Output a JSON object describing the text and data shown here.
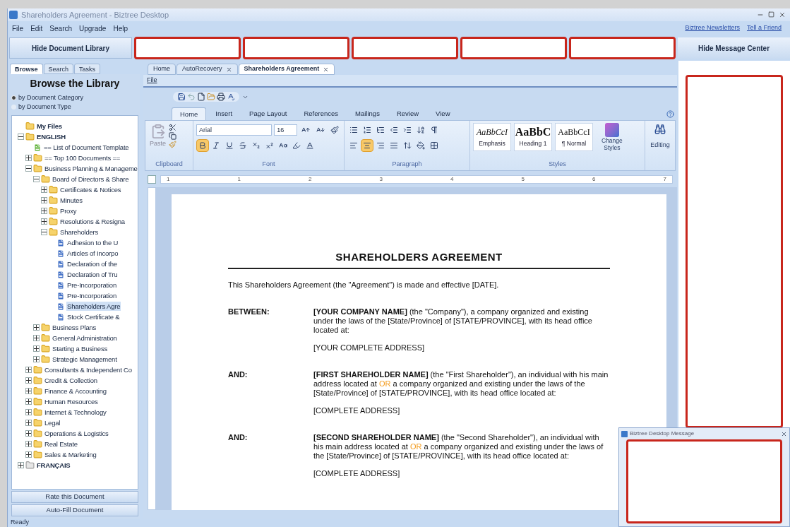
{
  "window": {
    "title": "Shareholders Agreement - Biztree Desktop"
  },
  "menu": [
    "File",
    "Edit",
    "Search",
    "Upgrade",
    "Help"
  ],
  "links": [
    "Biztree Newsletters",
    "Tell a Friend"
  ],
  "toolbar": {
    "left_button": "Hide Document Library",
    "right_button": "Hide Message Center"
  },
  "library": {
    "tabs": [
      {
        "label": "Browse",
        "selected": true
      },
      {
        "label": "Search",
        "selected": false
      },
      {
        "label": "Tasks",
        "selected": false
      }
    ],
    "heading": "Browse the Library",
    "options": [
      {
        "label": "by Document Category",
        "selected": true
      },
      {
        "label": "by Document Type",
        "selected": false
      }
    ],
    "tree": [
      {
        "label": "My Files",
        "kind": "folder",
        "bold": true,
        "selected": false
      },
      {
        "label": "ENGLISH",
        "kind": "folder",
        "bold": true,
        "expanded": true,
        "selected": false,
        "children": [
          {
            "label": "== List of Document Template",
            "kind": "list",
            "bold": false,
            "selected": false
          },
          {
            "label": "== Top 100 Documents ==",
            "kind": "folder",
            "bold": false,
            "expanded": false,
            "selected": false
          },
          {
            "label": "Business Planning & Manageme",
            "kind": "folder",
            "bold": false,
            "expanded": true,
            "selected": false,
            "children": [
              {
                "label": "Board of Directors & Share",
                "kind": "folder",
                "bold": false,
                "expanded": true,
                "selected": false,
                "children": [
                  {
                    "label": "Certificates & Notices",
                    "kind": "folder",
                    "bold": false,
                    "expanded": false,
                    "selected": false
                  },
                  {
                    "label": "Minutes",
                    "kind": "folder",
                    "bold": false,
                    "expanded": false,
                    "selected": false
                  },
                  {
                    "label": "Proxy",
                    "kind": "folder",
                    "bold": false,
                    "expanded": false,
                    "selected": false
                  },
                  {
                    "label": "Resolutions & Resigna",
                    "kind": "folder",
                    "bold": false,
                    "expanded": false,
                    "selected": false
                  },
                  {
                    "label": "Shareholders",
                    "kind": "folder",
                    "bold": false,
                    "expanded": true,
                    "selected": false,
                    "children": [
                      {
                        "label": "Adhesion to the U",
                        "kind": "document",
                        "bold": false,
                        "selected": false
                      },
                      {
                        "label": "Articles of Incorpo",
                        "kind": "document",
                        "bold": false,
                        "selected": false
                      },
                      {
                        "label": "Declaration of the",
                        "kind": "document",
                        "bold": false,
                        "selected": false
                      },
                      {
                        "label": "Declaration of Tru",
                        "kind": "document",
                        "bold": false,
                        "selected": false
                      },
                      {
                        "label": "Pre-Incorporation",
                        "kind": "document",
                        "bold": false,
                        "selected": false
                      },
                      {
                        "label": "Pre-Incorporation",
                        "kind": "document",
                        "bold": false,
                        "selected": false
                      },
                      {
                        "label": "Shareholders Agre",
                        "kind": "document",
                        "bold": false,
                        "selected": true
                      },
                      {
                        "label": "Stock Certificate &",
                        "kind": "document",
                        "bold": false,
                        "selected": false
                      }
                    ]
                  }
                ]
              },
              {
                "label": "Business Plans",
                "kind": "folder",
                "bold": false,
                "expanded": false,
                "selected": false
              },
              {
                "label": "General Administration",
                "kind": "folder",
                "bold": false,
                "expanded": false,
                "selected": false
              },
              {
                "label": "Starting a Business",
                "kind": "folder",
                "bold": false,
                "expanded": false,
                "selected": false
              },
              {
                "label": "Strategic Management",
                "kind": "folder",
                "bold": false,
                "expanded": false,
                "selected": false
              }
            ]
          },
          {
            "label": "Consultants & Independent Co",
            "kind": "folder",
            "bold": false,
            "expanded": false,
            "selected": false
          },
          {
            "label": "Credit & Collection",
            "kind": "folder",
            "bold": false,
            "expanded": false,
            "selected": false
          },
          {
            "label": "Finance & Accounting",
            "kind": "folder",
            "bold": false,
            "expanded": false,
            "selected": false
          },
          {
            "label": "Human Resources",
            "kind": "folder",
            "bold": false,
            "expanded": false,
            "selected": false
          },
          {
            "label": "Internet & Technology",
            "kind": "folder",
            "bold": false,
            "expanded": false,
            "selected": false
          },
          {
            "label": "Legal",
            "kind": "folder",
            "bold": false,
            "expanded": false,
            "selected": false
          },
          {
            "label": "Operations & Logistics",
            "kind": "folder",
            "bold": false,
            "expanded": false,
            "selected": false
          },
          {
            "label": "Real Estate",
            "kind": "folder",
            "bold": false,
            "expanded": false,
            "selected": false
          },
          {
            "label": "Sales & Marketing",
            "kind": "folder",
            "bold": false,
            "expanded": false,
            "selected": false
          }
        ]
      },
      {
        "label": "FRANÇAIS",
        "kind": "folder-grey",
        "bold": true,
        "expanded": false,
        "selected": false
      }
    ],
    "buttons": [
      "Rate this Document",
      "Auto-Fill Document"
    ]
  },
  "doc_tabs": [
    {
      "label": "Home",
      "closable": false,
      "selected": false
    },
    {
      "label": "AutoRecovery",
      "closable": true,
      "selected": false
    },
    {
      "label": "Shareholders Agreement",
      "closable": true,
      "selected": true
    }
  ],
  "file_menu": "File",
  "ribbon": {
    "tabs": [
      {
        "label": "Home",
        "selected": true
      },
      {
        "label": "Insert",
        "selected": false
      },
      {
        "label": "Page Layout",
        "selected": false
      },
      {
        "label": "References",
        "selected": false
      },
      {
        "label": "Mailings",
        "selected": false
      },
      {
        "label": "Review",
        "selected": false
      },
      {
        "label": "View",
        "selected": false
      }
    ],
    "paste": "Paste",
    "font_name": "Arial",
    "font_size": "16",
    "bold": true,
    "align_buttons": [
      {
        "kind": "left",
        "selected": false
      },
      {
        "kind": "center",
        "selected": true
      },
      {
        "kind": "right",
        "selected": false
      },
      {
        "kind": "justify",
        "selected": false
      }
    ],
    "styles": [
      {
        "preview": "AaBbCcI",
        "label": "Emphasis",
        "kind": "emphasis"
      },
      {
        "preview": "AaBbC",
        "label": "Heading 1",
        "kind": "heading"
      },
      {
        "preview": "AaBbCcI",
        "label": "¶ Normal",
        "kind": "normal"
      }
    ],
    "change_styles": [
      "Change",
      "Styles"
    ],
    "editing": "Editing",
    "groups": [
      "Clipboard",
      "Font",
      "Paragraph",
      "Styles"
    ],
    "ruler": [
      "1",
      "1",
      "2",
      "3",
      "4",
      "5",
      "6",
      "7"
    ]
  },
  "document": {
    "title": "SHAREHOLDERS AGREEMENT",
    "intro": "This Shareholders Agreement (the \"Agreement\") is made and effective [DATE].",
    "parties": [
      {
        "label": "BETWEEN:",
        "text": [
          {
            "kind": "bold",
            "text": "[YOUR COMPANY NAME]"
          },
          {
            "kind": "plain",
            "text": " (the \"Company\"), a company organized and existing under the laws of the [State/Province] of [STATE/PROVINCE], with its head office located at:"
          }
        ],
        "address": "[YOUR COMPLETE ADDRESS]"
      },
      {
        "label": "AND:",
        "text": [
          {
            "kind": "bold",
            "text": "[FIRST SHAREHOLDER NAME]"
          },
          {
            "kind": "plain",
            "text": " (the \"First Shareholder\"), an individual with his main address located at "
          },
          {
            "kind": "highlight",
            "text": "OR"
          },
          {
            "kind": "plain",
            "text": " a company organized and existing under the laws of the [State/Province] of [STATE/PROVINCE], with its head office located at:"
          }
        ],
        "address": "[COMPLETE ADDRESS]"
      },
      {
        "label": "AND:",
        "text": [
          {
            "kind": "bold",
            "text": "[SECOND SHAREHOLDER NAME]"
          },
          {
            "kind": "plain",
            "text": " (the \"Second Shareholder\"), an individual with his main address located at "
          },
          {
            "kind": "highlight",
            "text": "OR"
          },
          {
            "kind": "plain",
            "text": " a company organized and existing under the laws of the [State/Province] of [STATE/PROVINCE], with its head office located at:"
          }
        ],
        "address": "[COMPLETE ADDRESS]"
      }
    ]
  },
  "message": {
    "title": "Biztree Desktop Message"
  },
  "status_bar": "Ready"
}
